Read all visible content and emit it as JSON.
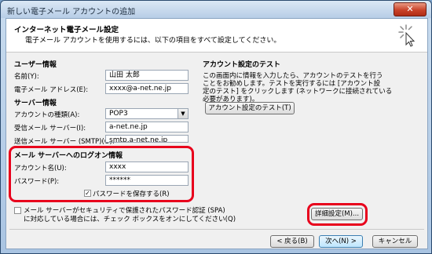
{
  "window": {
    "title": "新しい電子メール アカウントの追加",
    "close_symbol": "✕"
  },
  "header": {
    "title": "インターネット電子メール設定",
    "subtitle": "電子メール アカウントを使用するには、以下の項目をすべて設定してください。",
    "icon": "cursor-click-icon"
  },
  "user_info": {
    "section": "ユーザー情報",
    "name_label": "名前(Y):",
    "name_value": "山田 太郎",
    "email_label": "電子メール アドレス(E):",
    "email_value": "xxxx@a-net.ne.jp"
  },
  "server_info": {
    "section": "サーバー情報",
    "account_type_label": "アカウントの種類(A):",
    "account_type_value": "POP3",
    "incoming_label": "受信メール サーバー(I):",
    "incoming_value": "a-net.ne.jp",
    "outgoing_label": "送信メール サーバー (SMTP)(O):",
    "outgoing_value": "smtp.a-net.ne.jp"
  },
  "logon_info": {
    "section": "メール サーバーへのログオン情報",
    "account_label": "アカウント名(U):",
    "account_value": "xxxx",
    "password_label": "パスワード(P):",
    "password_value": "******",
    "remember_label": "パスワードを保存する(R)",
    "remember_checked": "✓"
  },
  "spa": {
    "line1": "メール サーバーがセキュリティで保護されたパスワード認証 (SPA)",
    "line2": "に対応している場合には、チェック ボックスをオンにしてください(Q)"
  },
  "test": {
    "section": "アカウント設定のテスト",
    "desc1": "この画面内に情報を入力したら、アカウントのテストを行う",
    "desc2": "ことをお勧めします。テストを実行するには [アカウント設",
    "desc3": "定のテスト] をクリックします (ネットワークに接続されている",
    "desc4": "必要があります)。",
    "button": "アカウント設定のテスト(T)"
  },
  "advanced_button": "詳細設定(M)...",
  "footer": {
    "back": "< 戻る(B)",
    "next": "次へ(N) >",
    "cancel": "キャンセル"
  },
  "colors": {
    "highlight": "#e8001c",
    "titlebar": "#b7cde6"
  }
}
